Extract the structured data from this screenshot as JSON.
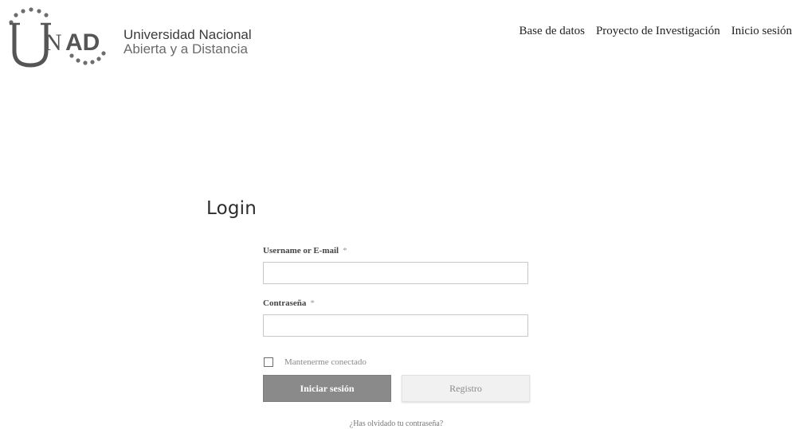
{
  "logo": {
    "mark_text": "UNAD",
    "name_line1": "Universidad Nacional",
    "name_line2": "Abierta y a Distancia"
  },
  "nav": {
    "items": [
      {
        "label": "Base de datos"
      },
      {
        "label": "Proyecto de Investigación"
      },
      {
        "label": "Inicio sesión"
      }
    ]
  },
  "login": {
    "title": "Login",
    "username_label": "Username or E-mail",
    "username_value": "",
    "password_label": "Contraseña",
    "password_value": "",
    "required_mark": "*",
    "remember_label": "Mantenerme conectado",
    "remember_checked": false,
    "submit_label": "Iniciar sesión",
    "register_label": "Registro",
    "forgot_label": "¿Has olvidado tu contraseña?"
  },
  "colors": {
    "primary_button": "#8a8a8a",
    "secondary_button": "#f1f1f1",
    "logo_gray": "#555555"
  }
}
